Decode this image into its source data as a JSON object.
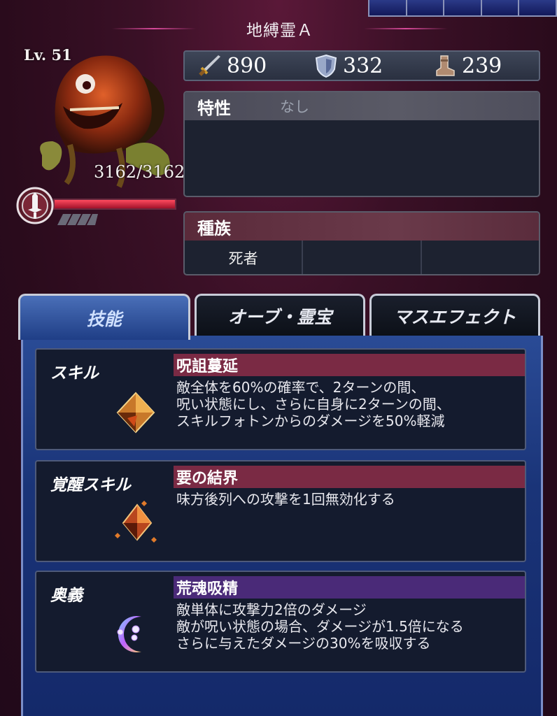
{
  "monster": {
    "name": "地縛霊Ａ",
    "level": "Lv. 51",
    "hp": "3162/3162",
    "hp_ratio": 1.0
  },
  "stats": {
    "attack": "890",
    "defense": "332",
    "speed": "239"
  },
  "traits": {
    "label": "特性",
    "value": "なし"
  },
  "race": {
    "label": "種族",
    "cells": [
      "死者",
      "",
      ""
    ]
  },
  "tabs": [
    {
      "label": "技能",
      "active": true
    },
    {
      "label": "オーブ・霊宝",
      "active": false
    },
    {
      "label": "マスエフェクト",
      "active": false
    }
  ],
  "skills": [
    {
      "category": "スキル",
      "name": "呪詛蔓延",
      "description": "敵全体を60%の確率で、2ターンの間、\n呪い状態にし、さらに自身に2ターンの間、\nスキルフォトンからのダメージを50%軽減",
      "header_color": "#7a2a44",
      "icon": "amber-crystal-icon"
    },
    {
      "category": "覚醒スキル",
      "name": "要の結界",
      "description": "味方後列への攻撃を1回無効化する",
      "header_color": "#7a2a44",
      "icon": "barrier-crystal-icon"
    },
    {
      "category": "奥義",
      "name": "荒魂吸精",
      "description": "敵単体に攻撃力2倍のダメージ\n敵が呪い状態の場合、ダメージが1.5倍になる\nさらに与えたダメージの30%を吸収する",
      "header_color": "#4a2a78",
      "icon": "crescent-moon-icon"
    }
  ]
}
